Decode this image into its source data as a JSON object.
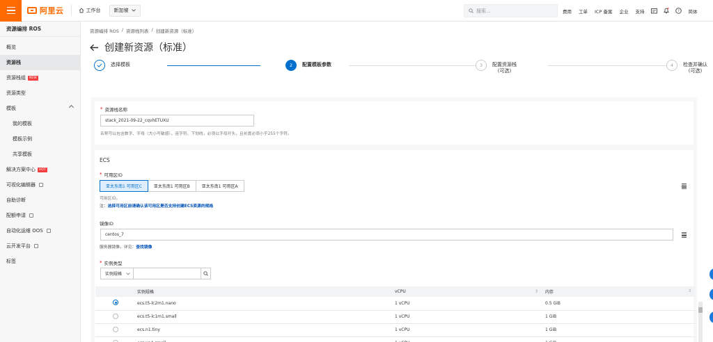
{
  "topbar": {
    "brand": "阿里云",
    "workbench": "工作台",
    "region": "新加坡",
    "search_placeholder": "搜索...",
    "links": [
      "费用",
      "工单",
      "ICP 备案",
      "企业",
      "支持"
    ],
    "lang": "简体"
  },
  "sidebar": {
    "title": "资源编排 ROS",
    "items": [
      {
        "label": "概览"
      },
      {
        "label": "资源栈",
        "active": true
      },
      {
        "label": "资源栈组",
        "badge": "NEW"
      },
      {
        "label": "资源类型"
      },
      {
        "label": "模板",
        "expandable": true
      },
      {
        "label": "我的模板",
        "sub": true
      },
      {
        "label": "模板示例",
        "sub": true
      },
      {
        "label": "共享模板",
        "sub": true
      },
      {
        "label": "解决方案中心",
        "badge": "HOT"
      },
      {
        "label": "可视化编辑器",
        "external": true
      },
      {
        "label": "自助诊断"
      },
      {
        "label": "配额申请",
        "external": true
      },
      {
        "label": "自动化运维 OOS",
        "external": true
      },
      {
        "label": "云开发平台",
        "external": true
      },
      {
        "label": "标签"
      }
    ]
  },
  "breadcrumb": [
    "资源编排 ROS",
    "资源栈列表",
    "创建新资源（标准）"
  ],
  "page_title": "创建新资源（标准）",
  "steps": [
    {
      "num": "",
      "label": "选择模板",
      "state": "done"
    },
    {
      "num": "2",
      "label": "配置模板参数",
      "state": "current"
    },
    {
      "num": "3",
      "label": "配置资源栈",
      "sub": "(可选)",
      "state": "todo"
    },
    {
      "num": "4",
      "label": "检查并确认",
      "sub": "(可选)",
      "state": "todo"
    }
  ],
  "stack_name": {
    "label": "资源栈名称",
    "value": "stack_2021-09-22_cqvhETUXU",
    "hint": "名称可以包含数字、字母（大小写敏感）、连字符、下划线，必须以字母开头，且长度必须小于255个字符。"
  },
  "ecs": {
    "section_title": "ECS",
    "zone_label": "可用区ID",
    "zones": [
      {
        "label": "亚太东南1 可用区C",
        "selected": true
      },
      {
        "label": "亚太东南1 可用区B",
        "selected": false
      },
      {
        "label": "亚太东南1 可用区A",
        "selected": false
      }
    ],
    "zone_hint": "可用区ID。",
    "zone_note_prefix": "注：",
    "zone_note": "选择可用区前请确认该可用区是否支持创建ECS资源的规格",
    "image_label": "镜像ID",
    "image_value": "centos_7",
    "image_hint": "服务器镜像，详见：",
    "image_link": "查找镜像",
    "instance_type_label": "实例类型",
    "filter_select": "实例规格",
    "table": {
      "headers": [
        "实例规格",
        "vCPU",
        "内存"
      ],
      "rows": [
        {
          "spec": "ecs.t5-lc2m1.nano",
          "vcpu": "1 vCPU",
          "mem": "0.5 GiB",
          "selected": true
        },
        {
          "spec": "ecs.t5-lc1m1.small",
          "vcpu": "1 vCPU",
          "mem": "1 GiB",
          "selected": false
        },
        {
          "spec": "ecs.n1.tiny",
          "vcpu": "1 vCPU",
          "mem": "1 GiB",
          "selected": false
        },
        {
          "spec": "ecs.xn4.small",
          "vcpu": "1 vCPU",
          "mem": "1 GiB",
          "selected": false
        }
      ]
    }
  },
  "colors": {
    "accent": "#ff6a00",
    "primary": "#0070cc"
  }
}
